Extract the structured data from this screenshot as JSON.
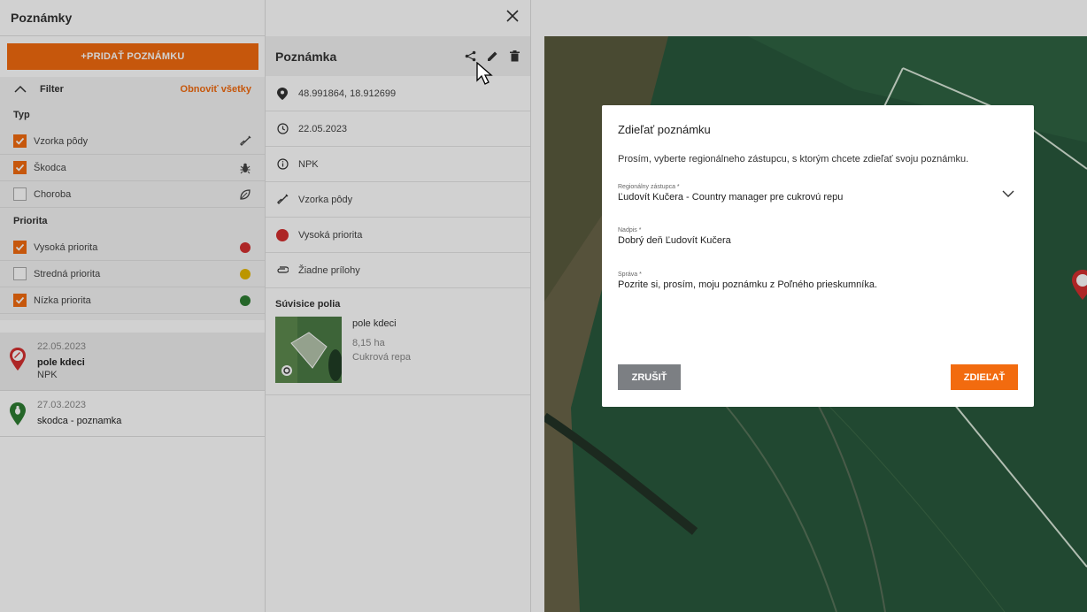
{
  "left": {
    "title": "Poznámky",
    "add_label": "+PRIDAŤ POZNÁMKU",
    "filter": {
      "label": "Filter",
      "reset_label": "Obnoviť všetky",
      "type_title": "Typ",
      "types": [
        {
          "label": "Vzorka pôdy",
          "checked": true,
          "icon": "shovel-icon"
        },
        {
          "label": "Škodca",
          "checked": true,
          "icon": "bug-icon"
        },
        {
          "label": "Choroba",
          "checked": false,
          "icon": "leaf-icon"
        }
      ],
      "priority_title": "Priorita",
      "priorities": [
        {
          "label": "Vysoká priorita",
          "checked": true,
          "color": "#d32f2f"
        },
        {
          "label": "Stredná priorita",
          "checked": false,
          "color": "#e6b800"
        },
        {
          "label": "Nízka priorita",
          "checked": true,
          "color": "#2e7d32"
        }
      ]
    },
    "notes": [
      {
        "date": "22.05.2023",
        "name": "pole kdeci",
        "type": "NPK",
        "pin_color": "#d32f2f"
      },
      {
        "date": "27.03.2023",
        "name": "skodca - poznamka",
        "pin_color": "#2e7d32"
      }
    ]
  },
  "detail": {
    "title": "Poznámka",
    "rows": [
      {
        "icon": "location-pin-icon",
        "text": "48.991864, 18.912699"
      },
      {
        "icon": "clock-icon",
        "text": "22.05.2023"
      },
      {
        "icon": "info-icon",
        "text": "NPK"
      },
      {
        "icon": "shovel-icon",
        "text": "Vzorka pôdy"
      },
      {
        "icon": "red-dot-icon",
        "text": "Vysoká priorita"
      },
      {
        "icon": "paperclip-icon",
        "text": "Žiadne prílohy"
      }
    ],
    "related_title": "Súvisice polia",
    "field": {
      "name": "pole kdeci",
      "area": "8,15 ha",
      "crop": "Cukrová repa"
    }
  },
  "dialog": {
    "title": "Zdieľať poznámku",
    "description": "Prosím, vyberte regionálneho zástupcu, s ktorým chcete zdieľať svoju poznámku.",
    "rep_label": "Regionálny zástupca *",
    "rep_value": "Ľudovít Kučera - Country manager pre cukrovú repu",
    "subject_label": "Nadpis *",
    "subject_value": "Dobrý deň Ľudovít Kučera",
    "message_label": "Správa *",
    "message_value": "Pozrite si, prosím, moju poznámku z Poľného prieskumníka.",
    "cancel_label": "ZRUŠIŤ",
    "share_label": "ZDIEĽAŤ"
  },
  "colors": {
    "accent": "#f26b0f"
  }
}
